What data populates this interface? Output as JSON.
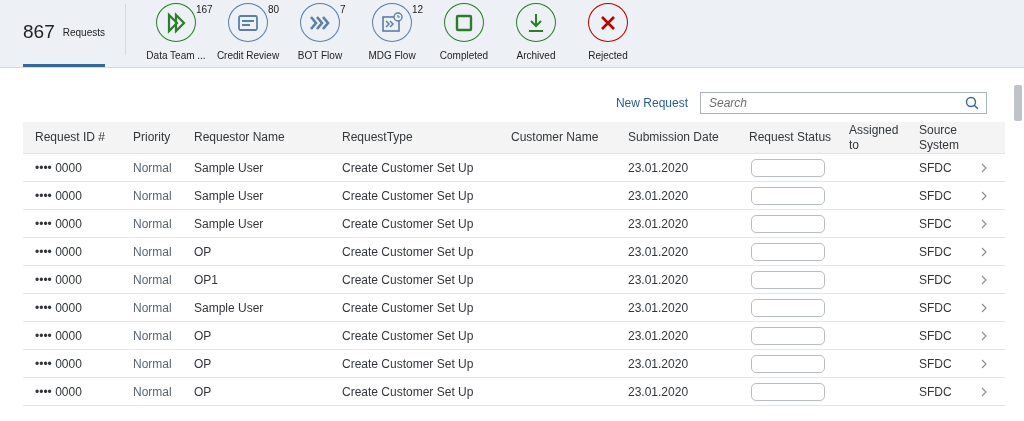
{
  "header_tabs": [
    {
      "kind": "count",
      "count": "867",
      "label": "Requests",
      "selected": true
    },
    {
      "kind": "icon",
      "label": "Data Team ...",
      "count": "167",
      "color": "#2b7d2b",
      "selected": false
    },
    {
      "kind": "icon",
      "label": "Credit Review",
      "count": "80",
      "color": "#5a7fa8",
      "selected": false
    },
    {
      "kind": "icon",
      "label": "BOT Flow",
      "count": "7",
      "color": "#5a7fa8",
      "selected": false
    },
    {
      "kind": "icon",
      "label": "MDG Flow",
      "count": "12",
      "color": "#5a7fa8",
      "selected": false
    },
    {
      "kind": "icon",
      "label": "Completed",
      "color": "#2b7d2b",
      "selected": false
    },
    {
      "kind": "icon",
      "label": "Archived",
      "color": "#2b7d2b",
      "selected": false
    },
    {
      "kind": "icon",
      "label": "Rejected",
      "color": "#bb0000",
      "selected": false
    }
  ],
  "toolbar": {
    "new_request": "New Request",
    "search": {
      "placeholder": "Search"
    }
  },
  "table": {
    "columns": [
      "Request ID #",
      "Priority",
      "Requestor Name",
      "RequestType",
      "Customer Name",
      "Submission Date",
      "Request Status",
      "Assigned to",
      "Source System"
    ],
    "rows": [
      [
        "•••• 0000",
        "Normal",
        "Sample User",
        "Create Customer Set Up",
        "",
        "23.01.2020",
        "",
        "",
        "SFDC"
      ],
      [
        "•••• 0000",
        "Normal",
        "Sample User",
        "Create Customer Set Up",
        "",
        "23.01.2020",
        "",
        "",
        "SFDC"
      ],
      [
        "•••• 0000",
        "Normal",
        "Sample User",
        "Create Customer Set Up",
        "",
        "23.01.2020",
        "",
        "",
        "SFDC"
      ],
      [
        "•••• 0000",
        "Normal",
        "OP",
        "Create Customer Set Up",
        "",
        "23.01.2020",
        "",
        "",
        "SFDC"
      ],
      [
        "•••• 0000",
        "Normal",
        "OP1",
        "Create Customer Set Up",
        "",
        "23.01.2020",
        "",
        "",
        "SFDC"
      ],
      [
        "•••• 0000",
        "Normal",
        "Sample User",
        "Create Customer Set Up",
        "",
        "23.01.2020",
        "",
        "",
        "SFDC"
      ],
      [
        "•••• 0000",
        "Normal",
        "OP",
        "Create Customer Set Up",
        "",
        "23.01.2020",
        "",
        "",
        "SFDC"
      ],
      [
        "•••• 0000",
        "Normal",
        "OP",
        "Create Customer Set Up",
        "",
        "23.01.2020",
        "",
        "",
        "SFDC"
      ],
      [
        "•••• 0000",
        "Normal",
        "OP",
        "Create Customer Set Up",
        "",
        "23.01.2020",
        "",
        "",
        "SFDC"
      ]
    ]
  }
}
